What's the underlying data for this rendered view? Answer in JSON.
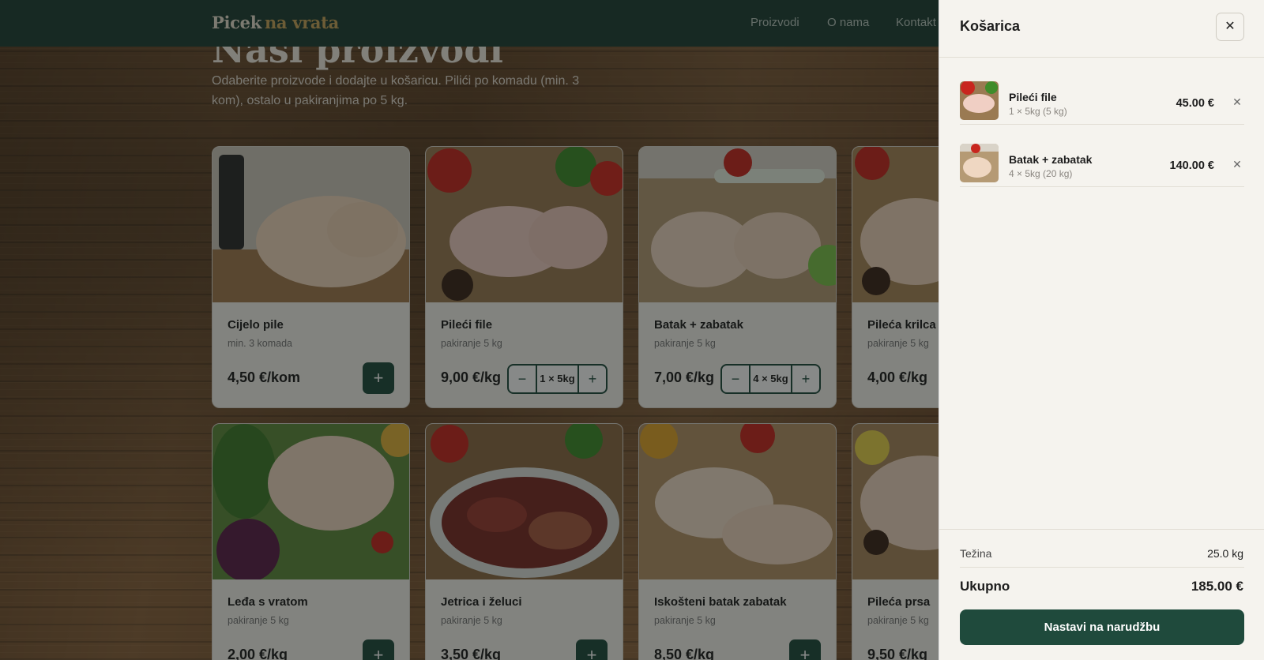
{
  "header": {
    "logo_main": "Picek",
    "logo_accent": "na vrata",
    "nav": [
      "Proizvodi",
      "O nama",
      "Kontakt"
    ]
  },
  "hero": {
    "title": "Naši proizvodi",
    "subtitle": "Odaberite proizvode i dodajte u košaricu. Pilići po komadu (min. 3 kom), ostalo u pakiranjima po 5 kg."
  },
  "products": [
    {
      "name": "Cijelo pile",
      "note": "min. 3 komada",
      "price": "4,50 €/kom",
      "add": "+"
    },
    {
      "name": "Pileći file",
      "note": "pakiranje 5 kg",
      "price": "9,00 €/kg",
      "minus": "−",
      "qty": "1 × 5kg",
      "plus": "+"
    },
    {
      "name": "Batak + zabatak",
      "note": "pakiranje 5 kg",
      "price": "7,00 €/kg",
      "minus": "−",
      "qty": "4 × 5kg",
      "plus": "+"
    },
    {
      "name": "Pileća krilca",
      "note": "pakiranje 5 kg",
      "price": "4,00 €/kg"
    },
    {
      "name": "Leđa s vratom",
      "note": "pakiranje 5 kg",
      "price": "2,00 €/kg",
      "add": "+"
    },
    {
      "name": "Jetrica i želuci",
      "note": "pakiranje 5 kg",
      "price": "3,50 €/kg",
      "add": "+"
    },
    {
      "name": "Iskošteni batak zabatak",
      "note": "pakiranje 5 kg",
      "price": "8,50 €/kg",
      "add": "+"
    },
    {
      "name": "Pileća prsa",
      "note": "pakiranje 5 kg",
      "price": "9,50 €/kg"
    }
  ],
  "cart": {
    "title": "Košarica",
    "close": "✕",
    "items": [
      {
        "name": "Pileći file",
        "qty": "1 × 5kg (5 kg)",
        "price": "45.00 €",
        "remove": "✕"
      },
      {
        "name": "Batak + zabatak",
        "qty": "4 × 5kg (20 kg)",
        "price": "140.00 €",
        "remove": "✕"
      }
    ],
    "weight_label": "Težina",
    "weight_value": "25.0 kg",
    "total_label": "Ukupno",
    "total_value": "185.00 €",
    "checkout": "Nastavi na narudžbu"
  },
  "colors": {
    "brand_green": "#1f4a3c",
    "header_green": "#1f3e34",
    "logo_accent": "#c9a45a",
    "drawer_bg": "#f5f3ee"
  }
}
